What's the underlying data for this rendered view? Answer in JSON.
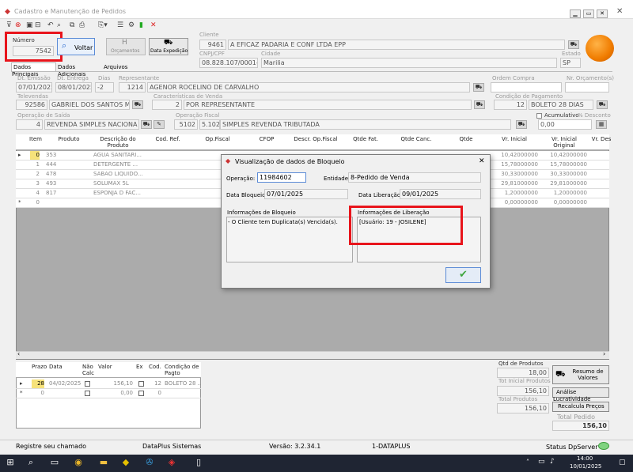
{
  "window": {
    "title": "Cadastro e Manutenção de Pedidos",
    "min": "▁",
    "max": "▭",
    "close": "✕"
  },
  "header": {
    "numero_label": "Número",
    "numero": "7542",
    "voltar": "Voltar",
    "orcamentos": "Orçamentos",
    "data_expedicao": "Data Expedição",
    "cliente_label": "Cliente",
    "cliente_cod": "9461",
    "cliente_nome": "A EFICAZ PADARIA E CONF LTDA EPP",
    "cnpj_label": "CNPJ/CPF",
    "cnpj": "08.828.107/0001-34",
    "cidade_label": "Cidade",
    "cidade": "Marilia",
    "estado_label": "Estado",
    "estado": "SP"
  },
  "tabs": [
    {
      "label": "Dados Principais"
    },
    {
      "label": "Dados Adicionais"
    },
    {
      "label": "Arquivos"
    }
  ],
  "form": {
    "emissao_label": "Dt. Emissão",
    "emissao": "07/01/2025",
    "entrega_label": "Dt. Entrega",
    "entrega": "08/01/2025",
    "dias_label": "Dias",
    "dias": "-2",
    "representante_label": "Representante",
    "rep_cod": "1214",
    "rep_nome": "AGENOR ROCELINO DE CARVALHO",
    "ordem_label": "Ordem Compra",
    "norc_label": "Nr. Orçamento(s)",
    "televendas_label": "Televendas",
    "tv_cod": "92586",
    "tv_nome": "GABRIEL DOS SANTOS M",
    "caract_label": "Características de Venda",
    "caract_cod": "2",
    "caract_nome": "POR REPRESENTANTE",
    "condpag_label": "Condição de Pagamento",
    "condpag_cod": "12",
    "condpag_nome": "BOLETO 28 DIAS",
    "opsaida_label": "Operação de Saída",
    "opsaida_cod": "4",
    "opsaida_nome": "REVENDA SIMPLES NACIONA",
    "opfiscal_label": "Operação Fiscal",
    "opfiscal_cod": "5102",
    "opfiscal_num": "5.102",
    "opfiscal_nome": "SIMPLES REVENDA TRIBUTADA",
    "acumulativo_label": "Acumulativo",
    "desconto_label": "% Desconto",
    "desconto": "0,00"
  },
  "items": {
    "headers": [
      "Item",
      "Produto",
      "Descrição do Produto",
      "Cod. Ref.",
      "Op.Fiscal",
      "CFOP",
      "Descr. Op.Fiscal",
      "Qtde Fat.",
      "Qtde Canc.",
      "Qtde",
      "Vr. Inicial",
      "Vr. Inicial Original",
      "Vr. Des"
    ],
    "rows": [
      {
        "item": "0",
        "prod": "353",
        "desc": "AGUA SANITARI...",
        "vi": "10,42000000",
        "vo": "10,42000000"
      },
      {
        "item": "1",
        "prod": "444",
        "desc": "DETERGENTE ...",
        "vi": "15,78000000",
        "vo": "15,78000000"
      },
      {
        "item": "2",
        "prod": "478",
        "desc": "SABAO LIQUIDO...",
        "vi": "30,33000000",
        "vo": "30,33000000"
      },
      {
        "item": "3",
        "prod": "493",
        "desc": "SOLUMAX 5L",
        "vi": "29,81000000",
        "vo": "29,81000000"
      },
      {
        "item": "4",
        "prod": "817",
        "desc": "ESPONJA D FAC...",
        "vi": "1,20000000",
        "vo": "1,20000000"
      },
      {
        "item": "0",
        "prod": "",
        "desc": "",
        "vi": "0,00000000",
        "vo": "0,00000000"
      }
    ]
  },
  "parcelas": {
    "headers": [
      "Prazo",
      "Data",
      "Não Calc",
      "Valor",
      "Ex",
      "Cod.",
      "Condição de Pagto"
    ],
    "rows": [
      {
        "prazo": "28",
        "data": "04/02/2025",
        "valor": "156,10",
        "cod": "12",
        "cond": "BOLETO 28 ..."
      },
      {
        "prazo": "0",
        "data": "",
        "valor": "0,00",
        "cod": "0",
        "cond": ""
      }
    ]
  },
  "totais": {
    "qtd_label": "Qtd de Produtos",
    "qtd": "18,00",
    "tot_ini_label": "Tot Inicial Produtos",
    "tot_ini": "156,10",
    "tot_prod_label": "Total Produtos",
    "tot_prod": "156,10",
    "tot_ped_label": "Total Pedido",
    "tot_ped": "156,10",
    "resumo": "Resumo de Valores",
    "analise": "Análise Lucratividade",
    "recalcula": "Recalcula Preços"
  },
  "dialog": {
    "title": "Visualização de dados de Bloqueio",
    "operacao_label": "Operação:",
    "operacao": "11984602",
    "entidade_label": "Entidade:",
    "entidade": "8-Pedido de Venda",
    "data_bloqueio_label": "Data Bloqueio:",
    "data_bloqueio": "07/01/2025",
    "data_lib_label": "Data Liberação:",
    "data_lib": "09/01/2025",
    "info_bloq_label": "Informações de Bloqueio",
    "info_bloq": "- O Cliente tem Duplicata(s) Vencida(s).",
    "info_lib_label": "Informações de Liberação",
    "info_lib": "[Usuário: 19 - JOSILENE]",
    "close": "✕",
    "ok": "✔"
  },
  "statusbar": {
    "s1": "Registre seu chamado",
    "s2": "DataPlus Sistemas",
    "s3": "Versão: 3.2.34.1",
    "s4": "1-DATAPLUS",
    "s5": "Status DpServer"
  },
  "taskbar": {
    "time": "14:00",
    "date": "10/01/2025"
  }
}
